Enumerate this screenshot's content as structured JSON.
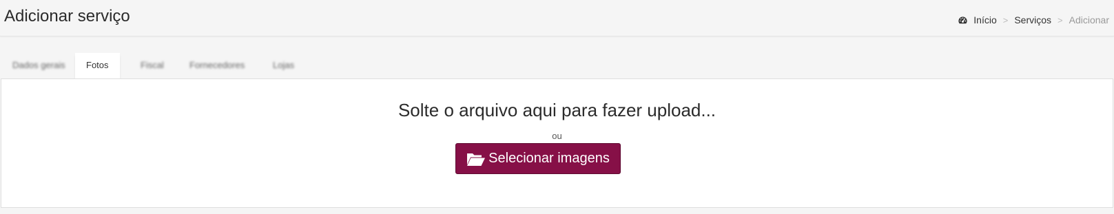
{
  "header": {
    "title": "Adicionar serviço",
    "breadcrumb": {
      "home_icon": "dashboard-icon",
      "items": [
        "Início",
        "Serviços",
        "Adicionar"
      ],
      "separator": ">"
    }
  },
  "tabs": [
    {
      "label": "Dados gerais",
      "active": false
    },
    {
      "label": "Fotos",
      "active": true
    },
    {
      "label": "Fiscal",
      "active": false
    },
    {
      "label": "Fornecedores",
      "active": false
    },
    {
      "label": "Lojas",
      "active": false
    }
  ],
  "dropzone": {
    "message": "Solte o arquivo aqui para fazer upload...",
    "or_text": "ou",
    "button_label": "Selecionar imagens",
    "button_icon": "folder-open-icon",
    "button_color": "#861047"
  }
}
